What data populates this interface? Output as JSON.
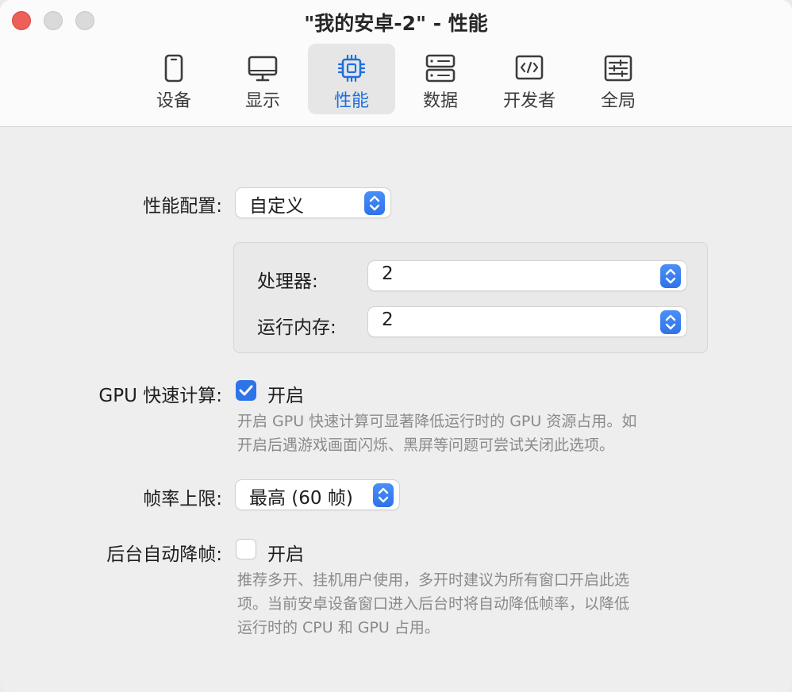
{
  "window": {
    "title": "\"我的安卓-2\" - 性能"
  },
  "tabs": [
    {
      "id": "device",
      "label": "设备",
      "icon": "phone-icon"
    },
    {
      "id": "display",
      "label": "显示",
      "icon": "monitor-icon"
    },
    {
      "id": "performance",
      "label": "性能",
      "icon": "cpu-icon",
      "active": true
    },
    {
      "id": "data",
      "label": "数据",
      "icon": "server-icon"
    },
    {
      "id": "developer",
      "label": "开发者",
      "icon": "code-icon"
    },
    {
      "id": "global",
      "label": "全局",
      "icon": "sliders-icon"
    }
  ],
  "performance": {
    "profile_label": "性能配置:",
    "profile_value": "自定义",
    "cpu_label": "处理器:",
    "cpu_value": "2",
    "memory_label": "运行内存:",
    "memory_value": "2",
    "gpu_label": "GPU 快速计算:",
    "gpu_checkbox_label": "开启",
    "gpu_checked": true,
    "gpu_help_line1": "开启 GPU 快速计算可显著降低运行时的 GPU 资源占用。如",
    "gpu_help_line2": "开启后遇游戏画面闪烁、黑屏等问题可尝试关闭此选项。",
    "fps_label": "帧率上限:",
    "fps_value": "最高 (60 帧)",
    "bg_label": "后台自动降帧:",
    "bg_checkbox_label": "开启",
    "bg_checked": false,
    "bg_help_line1": "推荐多开、挂机用户使用，多开时建议为所有窗口开启此选",
    "bg_help_line2": "项。当前安卓设备窗口进入后台时将自动降低帧率，以降低",
    "bg_help_line3": "运行时的 CPU 和 GPU 占用。"
  },
  "colors": {
    "accent": "#2f73e8",
    "close": "#ee5f57",
    "help_text": "#8a8a8a"
  }
}
